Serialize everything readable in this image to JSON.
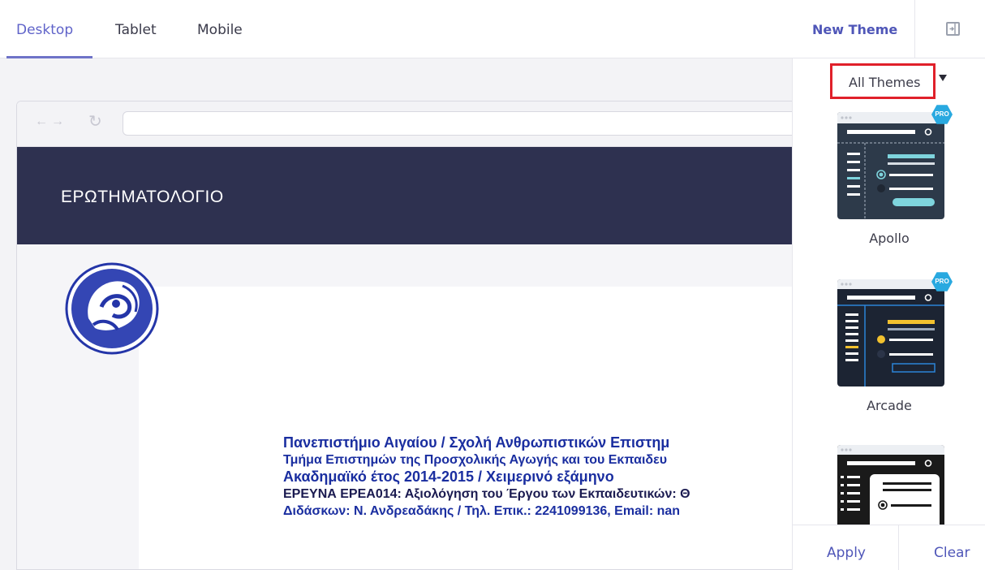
{
  "tabs": [
    {
      "label": "Desktop",
      "active": true
    },
    {
      "label": "Tablet",
      "active": false
    },
    {
      "label": "Mobile",
      "active": false
    }
  ],
  "header": {
    "new_theme_label": "New Theme",
    "collapse_icon": "panel-collapse-icon"
  },
  "preview": {
    "browser_nav_icons": [
      "back-arrow-icon",
      "forward-arrow-icon",
      "reload-icon"
    ],
    "form_title": "ΕΡΩΤΗΜΑΤΟΛΟΓΙΟ",
    "header_bg_color": "#2e3150",
    "document_lines": [
      "Πανεπιστήμιο Αιγαίου / Σχολή Ανθρωπιστικών Επιστημ",
      "Τμήμα Επιστημών της Προσχολικής Αγωγής και του Εκπαιδευ",
      "Ακαδημαϊκό έτος 2014-2015 / Χειμερινό εξάμηνο",
      "ΕΡΕΥΝΑ ΕΡΕΑ014: Αξιολόγηση του Έργου των Εκπαιδευτικών: Θ",
      "Διδάσκων: Ν. Ανδρεαδάκης / Τηλ. Επικ.: 2241099136, Email: nan"
    ],
    "logo_icon": "university-seal-icon"
  },
  "theme_panel": {
    "filter_label": "All Themes",
    "themes": [
      {
        "name": "Apollo",
        "pro": true,
        "badge": "PRO",
        "accent": "#7ed4dd",
        "bg": "#2d3a4a"
      },
      {
        "name": "Arcade",
        "pro": true,
        "badge": "PRO",
        "accent": "#f2c12e",
        "bg": "#1c2433"
      },
      {
        "name": "",
        "pro": false,
        "badge": "",
        "accent": "#ffffff",
        "bg": "#1a1a1a"
      }
    ],
    "apply_label": "Apply",
    "clear_label": "Clear"
  },
  "colors": {
    "accent": "#5f63c9",
    "highlight_border": "#e0202a",
    "pro_badge": "#29a9e0"
  }
}
